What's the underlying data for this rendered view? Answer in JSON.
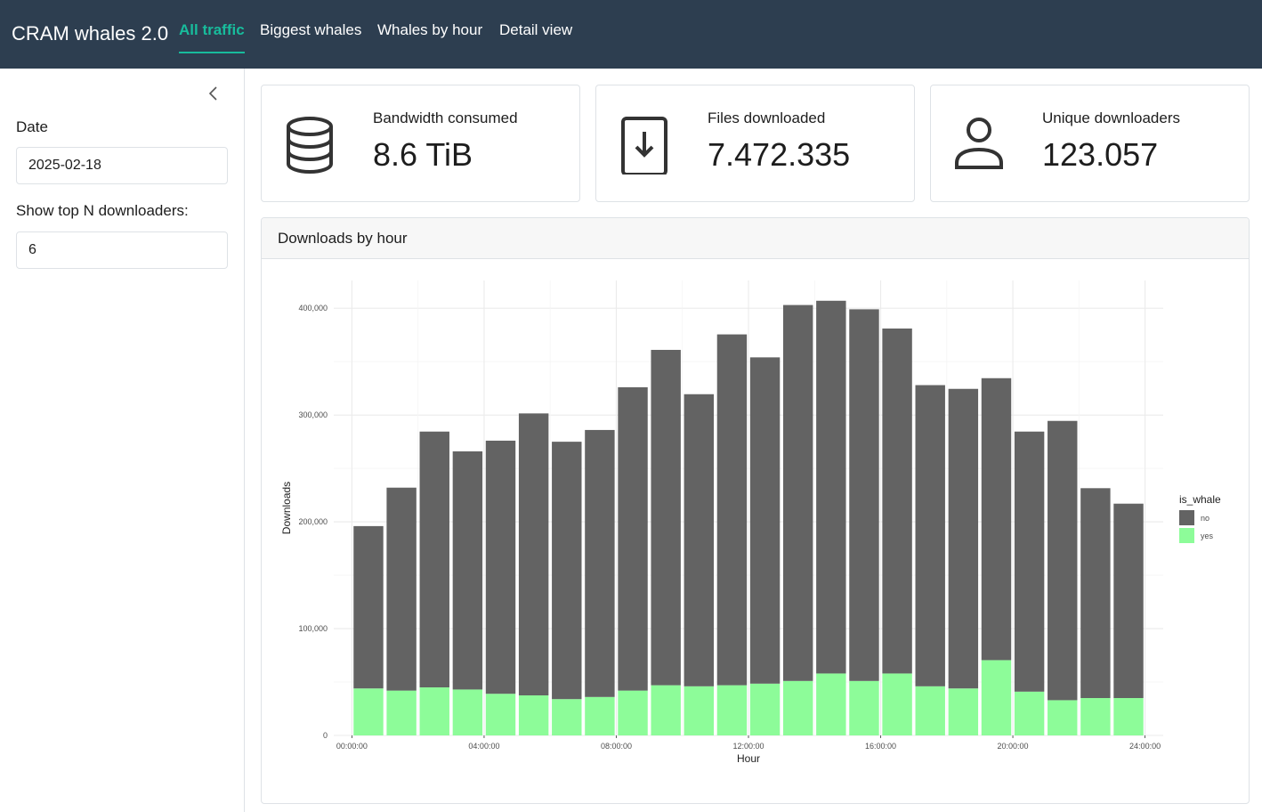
{
  "app": {
    "title": "CRAM whales 2.0",
    "tabs": [
      {
        "label": "All traffic",
        "active": true
      },
      {
        "label": "Biggest whales",
        "active": false
      },
      {
        "label": "Whales by hour",
        "active": false
      },
      {
        "label": "Detail view",
        "active": false
      }
    ]
  },
  "sidebar": {
    "collapse_icon": "chevron-left-icon",
    "date_label": "Date",
    "date_value": "2025-02-18",
    "topn_label": "Show top N downloaders:",
    "topn_value": "6"
  },
  "value_boxes": [
    {
      "icon": "database-icon",
      "title": "Bandwidth consumed",
      "value": "8.6 TiB"
    },
    {
      "icon": "file-download-icon",
      "title": "Files downloaded",
      "value": "7.472.335"
    },
    {
      "icon": "person-icon",
      "title": "Unique downloaders",
      "value": "123.057"
    }
  ],
  "card": {
    "title": "Downloads by hour"
  },
  "colors": {
    "navbar": "#2d3e50",
    "accent": "#18bc9c",
    "no": "#636363",
    "yes": "#8dfc99"
  },
  "chart_data": {
    "type": "bar",
    "stacked": true,
    "xlabel": "Hour",
    "ylabel": "Downloads",
    "x_ticks": [
      "00:00:00",
      "04:00:00",
      "08:00:00",
      "12:00:00",
      "16:00:00",
      "20:00:00",
      "24:00:00"
    ],
    "y_ticks": [
      "0",
      "100,000",
      "200,000",
      "300,000",
      "400,000"
    ],
    "ylim": [
      0,
      426000
    ],
    "legend_title": "is_whale",
    "legend_position": "right",
    "grid": true,
    "x": [
      "00:00",
      "01:00",
      "02:00",
      "03:00",
      "04:00",
      "05:00",
      "06:00",
      "07:00",
      "08:00",
      "09:00",
      "10:00",
      "11:00",
      "12:00",
      "13:00",
      "14:00",
      "15:00",
      "16:00",
      "17:00",
      "18:00",
      "19:00",
      "20:00",
      "21:00",
      "22:00",
      "23:00"
    ],
    "series": [
      {
        "name": "yes",
        "values": [
          44000,
          42000,
          45000,
          43000,
          39000,
          37500,
          34000,
          36000,
          42000,
          47000,
          46000,
          47000,
          48500,
          51000,
          58000,
          51000,
          58000,
          46000,
          44000,
          70500,
          41000,
          33000,
          35000,
          35000
        ]
      },
      {
        "name": "no",
        "values": [
          152000,
          190000,
          239500,
          223000,
          237000,
          264000,
          241000,
          250000,
          284000,
          314000,
          273500,
          328500,
          305500,
          352000,
          349000,
          348000,
          323000,
          282000,
          280500,
          264000,
          243500,
          261500,
          196500,
          182000
        ]
      }
    ]
  }
}
